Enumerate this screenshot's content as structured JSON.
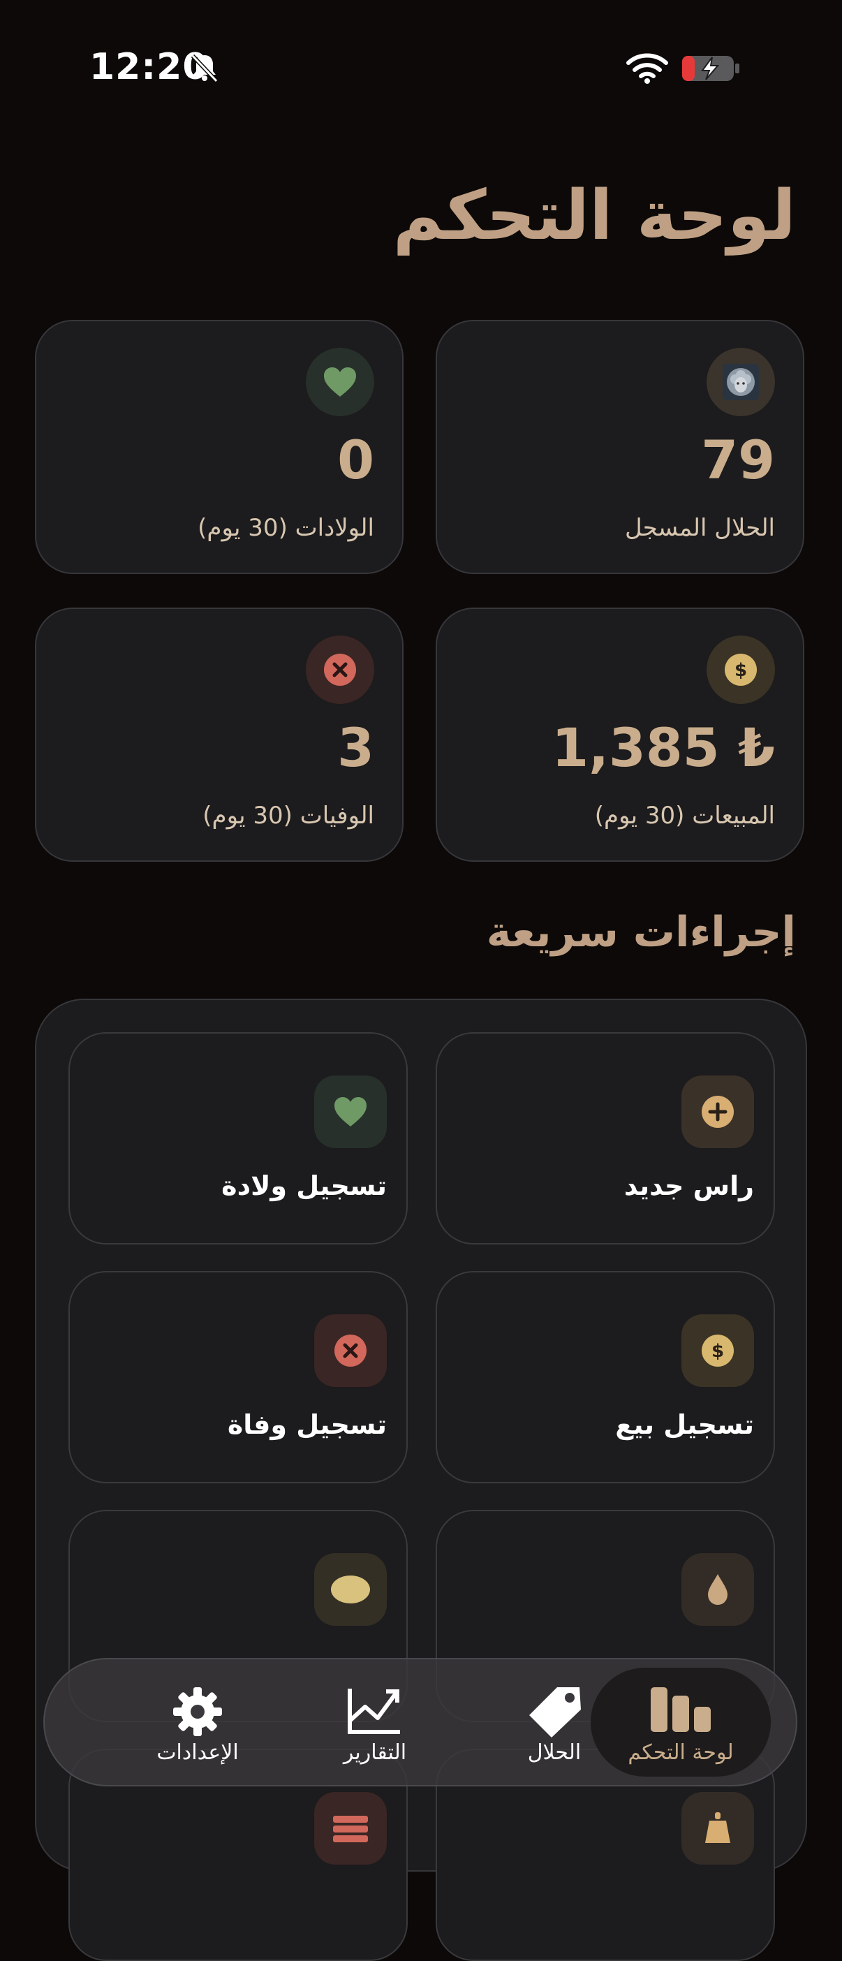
{
  "status_bar": {
    "time": "12:20"
  },
  "page_title": "لوحة التحكم",
  "stats": [
    {
      "value": "79",
      "label": "الحلال المسجل",
      "icon": "sheep-icon"
    },
    {
      "value": "0",
      "label": "الولادات (30 يوم)",
      "icon": "heart-icon"
    },
    {
      "value": "1,385 ₺",
      "label": "المبيعات (30 يوم)",
      "icon": "dollar-icon"
    },
    {
      "value": "3",
      "label": "الوفيات (30 يوم)",
      "icon": "close-icon"
    }
  ],
  "quick_actions_title": "إجراءات سريعة",
  "actions": [
    {
      "label": "راس جديد",
      "icon": "plus-icon"
    },
    {
      "label": "تسجيل ولادة",
      "icon": "heart-icon"
    },
    {
      "label": "تسجيل بيع",
      "icon": "dollar-icon"
    },
    {
      "label": "تسجيل وفاة",
      "icon": "close-icon"
    }
  ],
  "nav": [
    {
      "label": "لوحة التحكم",
      "icon": "dashboard-icon",
      "active": true
    },
    {
      "label": "الحلال",
      "icon": "tag-icon",
      "active": false
    },
    {
      "label": "التقارير",
      "icon": "chart-icon",
      "active": false
    },
    {
      "label": "الإعدادات",
      "icon": "gear-icon",
      "active": false
    }
  ],
  "colors": {
    "background": "#0c0908",
    "card": "#1c1b1d",
    "accent": "#c9ad8c",
    "green": "#6f9a66",
    "red": "#d2685c",
    "gold": "#d8b86e"
  }
}
